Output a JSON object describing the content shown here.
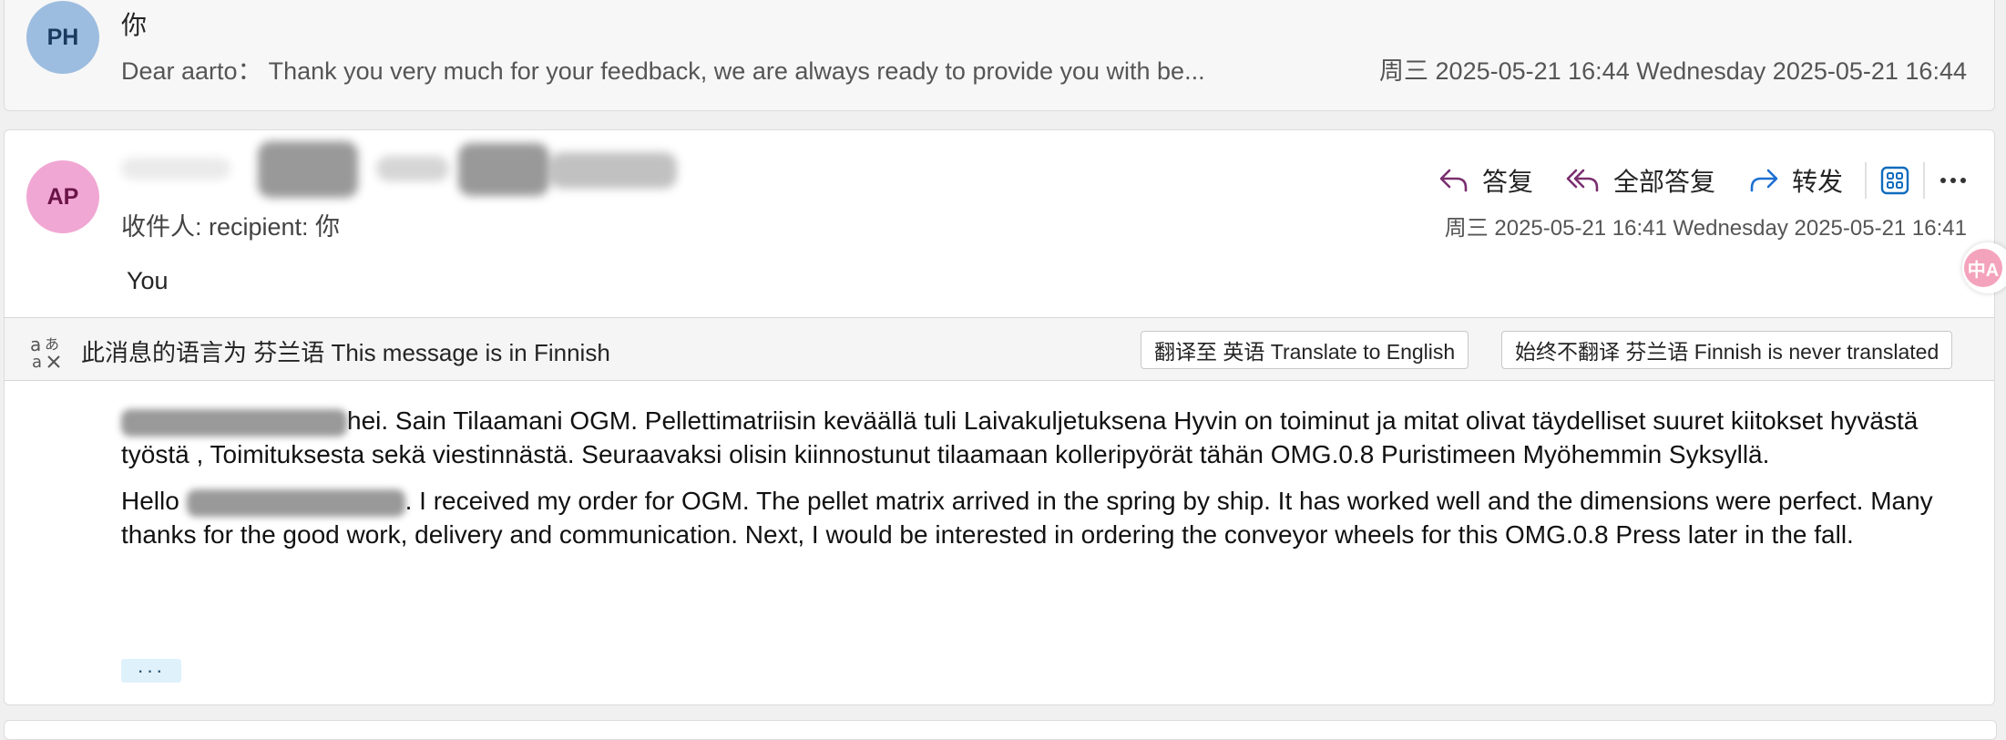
{
  "message1": {
    "avatar_initials": "PH",
    "sender": "你",
    "preview": "Dear aarto：  Thank you very much for your feedback, we are always ready to provide you with be...",
    "date": "周三 2025-05-21 16:44  Wednesday 2025-05-21 16:44"
  },
  "message2": {
    "avatar_initials": "AP",
    "recipient_line": "收件人:  recipient:  你",
    "you_label": "You",
    "date": "周三 2025-05-21 16:41  Wednesday 2025-05-21 16:41",
    "actions": {
      "reply": "答复",
      "reply_all": "全部答复",
      "forward": "转发"
    },
    "translation_bar": {
      "notice": "此消息的语言为 芬兰语  This message is in Finnish",
      "translate_button": "翻译至 英语  Translate to English",
      "never_translate_button": "始终不翻译 芬兰语  Finnish is never translated"
    },
    "body": {
      "finnish": "hei. Sain Tilaamani OGM. Pellettimatriisin keväällä tuli Laivakuljetuksena  Hyvin on toiminut ja mitat olivat täydelliset suuret kiitokset hyvästä työstä , Toimituksesta sekä viestinnästä. Seuraavaksi olisin kiinnostunut tilaamaan kolleripyörät  tähän OMG.0.8 Puristimeen  Myöhemmin Syksyllä.",
      "english_prefix": "Hello ",
      "english": ". I received my order for OGM. The pellet matrix arrived in the spring by ship. It has worked well and the dimensions were perfect. Many thanks for the good work, delivery and communication. Next, I would be interested in ordering the conveyor wheels for this OMG.0.8 Press later in the fall."
    },
    "more_label": "···"
  },
  "side_widget": {
    "label": "中A"
  },
  "colors": {
    "avatar_ph": "#9dbde0",
    "avatar_ap": "#f0a7d3",
    "reply_icon": "#7a2e6e",
    "forward_icon": "#1c6fd1",
    "accent": "#0f6cbd"
  }
}
